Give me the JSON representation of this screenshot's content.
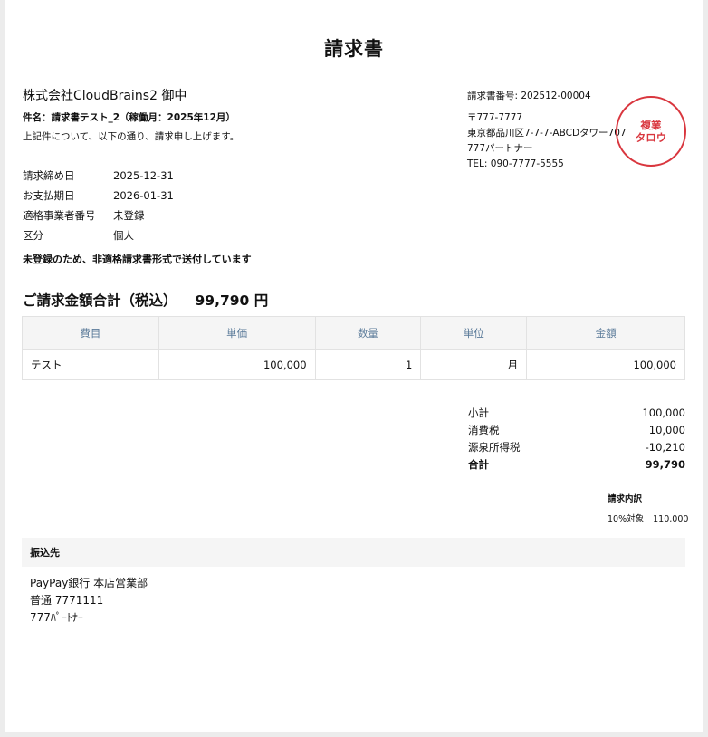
{
  "title": "請求書",
  "client": "株式会社CloudBrains2 御中",
  "subject": "件名：請求書テスト_2（稼働月：2025年12月）",
  "intro": "上記件について、以下の通り、請求申し上げます。",
  "meta": [
    {
      "label": "請求締め日",
      "value": "2025-12-31"
    },
    {
      "label": "お支払期日",
      "value": "2026-01-31"
    },
    {
      "label": "適格事業者番号",
      "value": "未登録"
    },
    {
      "label": "区分",
      "value": "個人"
    }
  ],
  "notice": "未登録のため、非適格請求書形式で送付しています",
  "issuer": {
    "invoice_no": "請求書番号: 202512-00004",
    "postal": "〒777-7777",
    "address": "東京都品川区7-7-7-ABCDタワー707",
    "name": "777パートナー",
    "tel": "TEL: 090-7777-5555"
  },
  "stamp": {
    "line1": "複業",
    "line2": "タロウ",
    "color": "#d9363e"
  },
  "total": {
    "label": "ご請求金額合計（税込）",
    "amount": "99,790 円"
  },
  "table": {
    "headers": [
      "費目",
      "単価",
      "数量",
      "単位",
      "金額"
    ],
    "rows": [
      [
        "テスト",
        "100,000",
        "1",
        "月",
        "100,000"
      ]
    ]
  },
  "summary": [
    {
      "label": "小計",
      "value": "100,000"
    },
    {
      "label": "消費税",
      "value": "10,000"
    },
    {
      "label": "源泉所得税",
      "value": "-10,210"
    },
    {
      "label": "合計",
      "value": "99,790"
    }
  ],
  "breakdown": {
    "title": "請求内訳",
    "rate": "10%対象",
    "amount": "110,000"
  },
  "bank": {
    "heading": "振込先",
    "line1": "PayPay銀行 本店営業部",
    "line2": "普通 7771111",
    "line3": "777ﾊﾟｰﾄﾅｰ"
  }
}
